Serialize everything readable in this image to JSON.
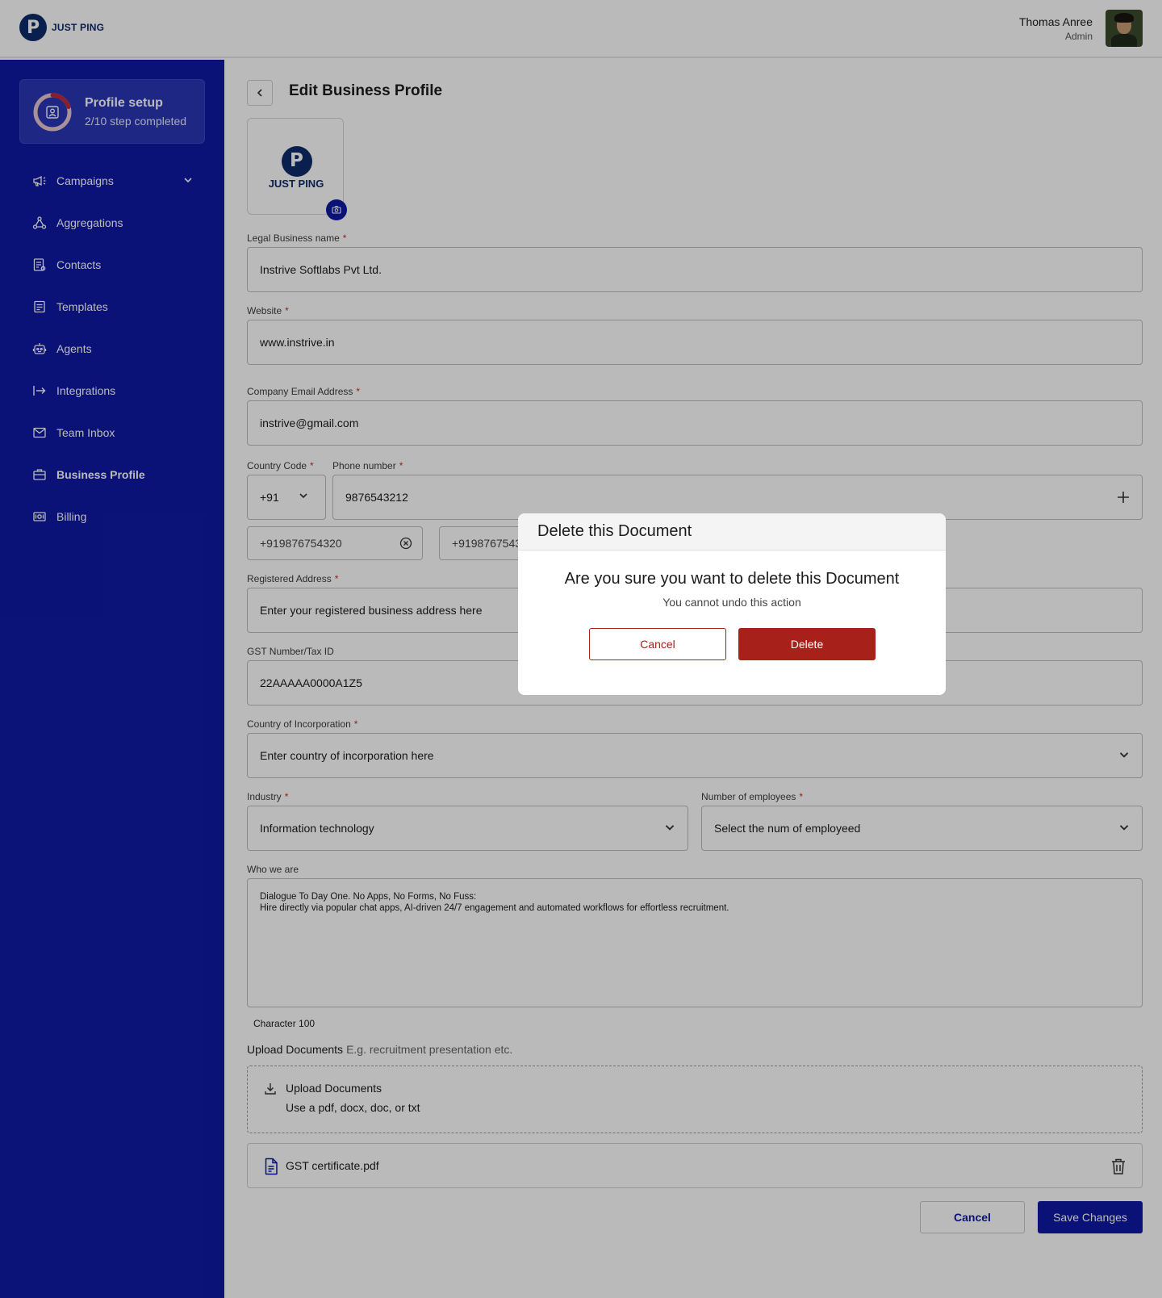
{
  "brand": {
    "name": "JUST PING",
    "letter": "P"
  },
  "user": {
    "name": "Thomas Anree",
    "role": "Admin"
  },
  "sidebar": {
    "profile": {
      "title": "Profile setup",
      "progress": "2/10 step completed",
      "progress_fraction": 0.2
    },
    "items": [
      {
        "label": "Campaigns",
        "icon": "megaphone-icon",
        "has_chevron": true
      },
      {
        "label": "Aggregations",
        "icon": "network-icon"
      },
      {
        "label": "Contacts",
        "icon": "contacts-icon"
      },
      {
        "label": "Templates",
        "icon": "template-icon"
      },
      {
        "label": "Agents",
        "icon": "robot-icon"
      },
      {
        "label": "Integrations",
        "icon": "integration-arrow-icon"
      },
      {
        "label": "Team Inbox",
        "icon": "mail-icon"
      },
      {
        "label": "Business Profile",
        "icon": "briefcase-icon",
        "active": true
      },
      {
        "label": "Billing",
        "icon": "billing-icon"
      }
    ]
  },
  "page": {
    "title": "Edit Business Profile"
  },
  "form": {
    "legal_name": {
      "label": "Legal Business name",
      "required_mark": "*",
      "value": "Instrive Softlabs Pvt Ltd."
    },
    "website": {
      "label": "Website",
      "required_mark": "*",
      "value": "www.instrive.in"
    },
    "email": {
      "label": "Company Email Address",
      "required_mark": "*",
      "value": "instrive@gmail.com"
    },
    "country_code": {
      "label": "Country Code",
      "required_mark": "*",
      "value": "+91"
    },
    "phone": {
      "label": "Phone number",
      "required_mark": "*",
      "value": "9876543212"
    },
    "phone_chips": [
      "+919876754320",
      "+919876754320"
    ],
    "address": {
      "label": "Registered Address",
      "required_mark": "*",
      "placeholder": "Enter your registered business address here"
    },
    "gst": {
      "label": "GST Number/Tax ID",
      "value": "22AAAAA0000A1Z5"
    },
    "country": {
      "label": "Country of Incorporation",
      "required_mark": "*",
      "placeholder": "Enter country of incorporation here"
    },
    "industry": {
      "label": "Industry",
      "required_mark": "*",
      "value": "Information technology"
    },
    "employees": {
      "label": "Number of employees",
      "required_mark": "*",
      "placeholder": "Select the num of employeed"
    },
    "about": {
      "label": "Who we are",
      "line1": "Dialogue To Day One. No Apps, No Forms, No Fuss:",
      "line2": "Hire directly via popular chat apps, AI-driven 24/7 engagement and automated workflows for effortless recruitment."
    },
    "char_count": "Character 100",
    "upload": {
      "title": "Upload Documents",
      "hint": "E.g. recruitment presentation etc.",
      "drop_title": "Upload Documents",
      "drop_sub": "Use a pdf, docx, doc, or txt"
    },
    "file": {
      "name": "GST certificate.pdf"
    },
    "actions": {
      "cancel": "Cancel",
      "save": "Save Changes"
    }
  },
  "modal": {
    "title": "Delete this Document",
    "question": "Are you sure you want to delete this Document",
    "subtitle": "You cannot undo this action",
    "cancel": "Cancel",
    "delete": "Delete"
  },
  "colors": {
    "sidebar": "#0f1aa5",
    "brand": "#0d2b6b",
    "danger": "#a8201a",
    "required": "#c4302b"
  }
}
